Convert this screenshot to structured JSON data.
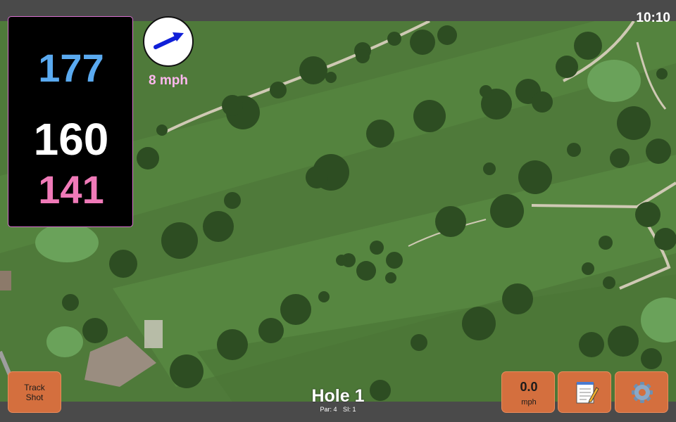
{
  "status": {
    "time": "10:10"
  },
  "distances": {
    "back": "177",
    "middle": "160",
    "front": "141"
  },
  "wind": {
    "speed_label": "8 mph",
    "icon": "wind-direction-arrow-icon"
  },
  "hole": {
    "title": "Hole 1",
    "par_label": "Par: 4",
    "si_label": "SI: 1"
  },
  "buttons": {
    "track_shot_line1": "Track",
    "track_shot_line2": "Shot",
    "speed_value": "0.0",
    "speed_unit": "mph",
    "notes_icon": "notepad-icon",
    "settings_icon": "gear-icon"
  },
  "colors": {
    "back_distance": "#5aaaf0",
    "middle_distance": "#ffffff",
    "front_distance": "#f07ab8",
    "button_bg": "#d46f3e",
    "wind_label": "#ffb8ef",
    "fairway": "#4f7a3a"
  }
}
